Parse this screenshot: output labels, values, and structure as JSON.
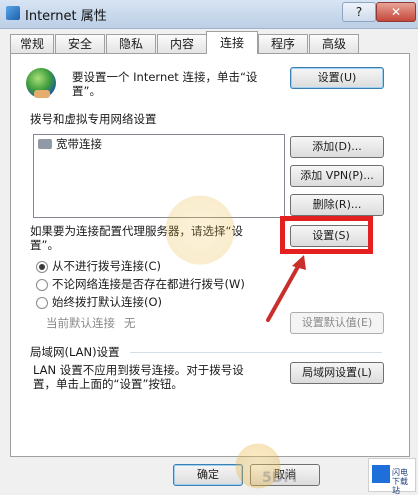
{
  "window": {
    "title": "Internet 属性",
    "help": "?",
    "close": "✕"
  },
  "tabs": [
    "常规",
    "安全",
    "隐私",
    "内容",
    "连接",
    "程序",
    "高级"
  ],
  "setup": {
    "text_line1": "要设置一个 Internet 连接，单击“设",
    "text_line2": "置”。",
    "button": "设置(U)"
  },
  "dialup": {
    "heading": "拨号和虚拟专用网络设置",
    "items": [
      "宽带连接"
    ],
    "add": "添加(D)...",
    "add_vpn": "添加 VPN(P)...",
    "remove": "删除(R)..."
  },
  "proxy": {
    "text_line1": "如果要为连接配置代理服务器，请选择“设",
    "text_line2": "置”。",
    "settings_button": "设置(S)",
    "radio_never": "从不进行拨号连接(C)",
    "radio_whenever": "不论网络连接是否存在都进行拨号(W)",
    "radio_always": "始终拨打默认连接(O)",
    "current_default_label": "当前默认连接",
    "current_default_value": "无",
    "set_default": "设置默认值(E)"
  },
  "lan": {
    "heading": "局域网(LAN)设置",
    "text_line1": "LAN 设置不应用到拨号连接。对于拨号设",
    "text_line2": "置，单击上面的“设置”按钮。",
    "button": "局域网设置(L)"
  },
  "footer": {
    "ok": "确定",
    "cancel": "取消"
  },
  "watermark": {
    "text": "5DM",
    "logo_line1": "闪电下载站",
    "logo_line2": ""
  },
  "colors": {
    "highlight": "#e41f1f",
    "arrow": "#c9302c"
  }
}
